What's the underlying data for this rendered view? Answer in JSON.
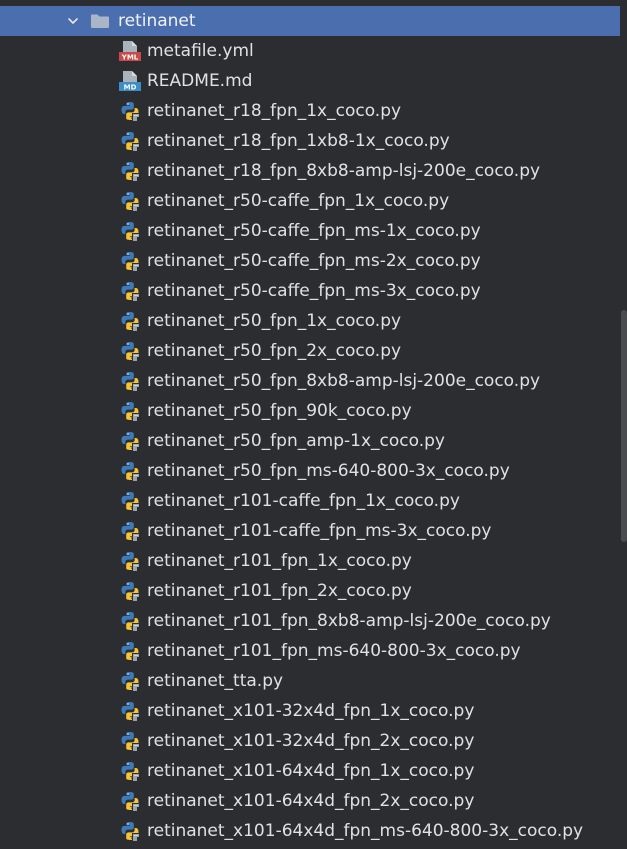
{
  "folder": {
    "name": "retinanet",
    "icon": "folder-icon",
    "expanded": true
  },
  "files": [
    {
      "name": "metafile.yml",
      "type": "yml"
    },
    {
      "name": "README.md",
      "type": "md"
    },
    {
      "name": "retinanet_r18_fpn_1x_coco.py",
      "type": "py"
    },
    {
      "name": "retinanet_r18_fpn_1xb8-1x_coco.py",
      "type": "py"
    },
    {
      "name": "retinanet_r18_fpn_8xb8-amp-lsj-200e_coco.py",
      "type": "py"
    },
    {
      "name": "retinanet_r50-caffe_fpn_1x_coco.py",
      "type": "py"
    },
    {
      "name": "retinanet_r50-caffe_fpn_ms-1x_coco.py",
      "type": "py"
    },
    {
      "name": "retinanet_r50-caffe_fpn_ms-2x_coco.py",
      "type": "py"
    },
    {
      "name": "retinanet_r50-caffe_fpn_ms-3x_coco.py",
      "type": "py"
    },
    {
      "name": "retinanet_r50_fpn_1x_coco.py",
      "type": "py"
    },
    {
      "name": "retinanet_r50_fpn_2x_coco.py",
      "type": "py"
    },
    {
      "name": "retinanet_r50_fpn_8xb8-amp-lsj-200e_coco.py",
      "type": "py"
    },
    {
      "name": "retinanet_r50_fpn_90k_coco.py",
      "type": "py"
    },
    {
      "name": "retinanet_r50_fpn_amp-1x_coco.py",
      "type": "py"
    },
    {
      "name": "retinanet_r50_fpn_ms-640-800-3x_coco.py",
      "type": "py"
    },
    {
      "name": "retinanet_r101-caffe_fpn_1x_coco.py",
      "type": "py"
    },
    {
      "name": "retinanet_r101-caffe_fpn_ms-3x_coco.py",
      "type": "py"
    },
    {
      "name": "retinanet_r101_fpn_1x_coco.py",
      "type": "py"
    },
    {
      "name": "retinanet_r101_fpn_2x_coco.py",
      "type": "py"
    },
    {
      "name": "retinanet_r101_fpn_8xb8-amp-lsj-200e_coco.py",
      "type": "py"
    },
    {
      "name": "retinanet_r101_fpn_ms-640-800-3x_coco.py",
      "type": "py"
    },
    {
      "name": "retinanet_tta.py",
      "type": "py"
    },
    {
      "name": "retinanet_x101-32x4d_fpn_1x_coco.py",
      "type": "py"
    },
    {
      "name": "retinanet_x101-32x4d_fpn_2x_coco.py",
      "type": "py"
    },
    {
      "name": "retinanet_x101-64x4d_fpn_1x_coco.py",
      "type": "py"
    },
    {
      "name": "retinanet_x101-64x4d_fpn_2x_coco.py",
      "type": "py"
    },
    {
      "name": "retinanet_x101-64x4d_fpn_ms-640-800-3x_coco.py",
      "type": "py"
    }
  ],
  "icon_labels": {
    "yml": "YML",
    "md": "MD"
  },
  "colors": {
    "selection": "#4b6eaf",
    "background": "#2b2d30",
    "python_blue": "#3d7ab8",
    "python_yellow": "#f5c338",
    "yml_red": "#c74b4b",
    "md_blue": "#3a8fc7"
  }
}
